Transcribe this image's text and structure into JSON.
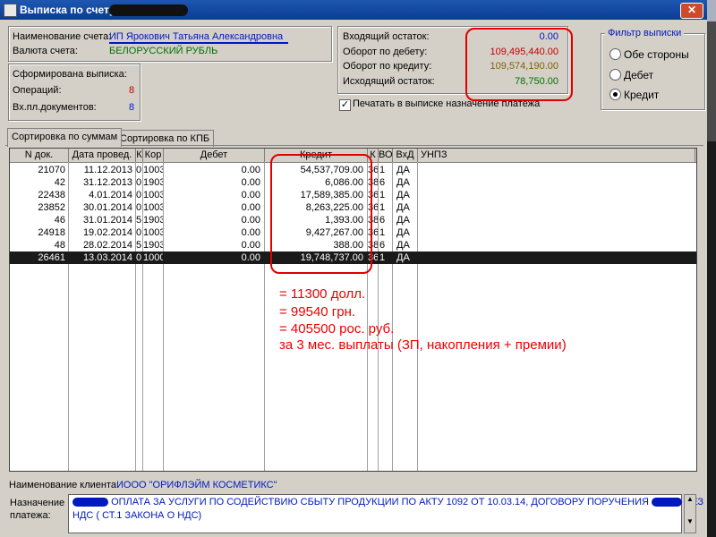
{
  "window": {
    "title": "Выписка по счету",
    "close_glyph": "✕"
  },
  "account": {
    "name_label": "Наименование счета:",
    "name_value": "ИП Ярокович Татьяна Александровна",
    "currency_label": "Валюта счета:",
    "currency_value": "БЕЛОРУССКИЙ РУБЛЬ"
  },
  "summary": {
    "title": "Сформирована выписка:",
    "operations_label": "Операций:",
    "operations_value": "8",
    "docs_label": "Вх.пл.документов:",
    "docs_value": "8"
  },
  "balances": {
    "opening_label": "Входящий остаток:",
    "opening_value": "0.00",
    "debit_label": "Оборот по дебету:",
    "debit_value": "109,495,440.00",
    "credit_label": "Оборот по кредиту:",
    "credit_value": "109,574,190.00",
    "closing_label": "Исходящий остаток:",
    "closing_value": "78,750.00"
  },
  "print_option": {
    "label": "Печатать в выписке назначение платежа",
    "checked": true
  },
  "filter": {
    "title": "Фильтр выписки",
    "options": [
      "Обе стороны",
      "Дебет",
      "Кредит"
    ],
    "selected": "Кредит"
  },
  "tabs": [
    {
      "label": "Сортировка по суммам",
      "active": true
    },
    {
      "label": "Сортировка по КПБ",
      "active": false
    }
  ],
  "table": {
    "columns": [
      "N док.",
      "Дата провед.",
      "К",
      "Кор",
      "Дебет",
      "Кредит",
      "К",
      "ВО",
      "ВхД",
      "УНПЗ"
    ],
    "rows": [
      [
        "21070",
        "11.12.2013",
        "0",
        "1003",
        "0.00",
        "54,537,709.00",
        "367",
        "1",
        "ДА",
        ""
      ],
      [
        "42",
        "31.12.2013",
        "0",
        "1903",
        "0.00",
        "6,086.00",
        "387",
        "6",
        "ДА",
        ""
      ],
      [
        "22438",
        "4.01.2014",
        "0",
        "1003",
        "0.00",
        "17,589,385.00",
        "367",
        "1",
        "ДА",
        ""
      ],
      [
        "23852",
        "30.01.2014",
        "0",
        "1003",
        "0.00",
        "8,263,225.00",
        "367",
        "1",
        "ДА",
        ""
      ],
      [
        "46",
        "31.01.2014",
        "5",
        "1903",
        "0.00",
        "1,393.00",
        "387",
        "6",
        "ДА",
        ""
      ],
      [
        "24918",
        "19.02.2014",
        "0",
        "1003",
        "0.00",
        "9,427,267.00",
        "367",
        "1",
        "ДА",
        ""
      ],
      [
        "48",
        "28.02.2014",
        "5",
        "1903",
        "0.00",
        "388.00",
        "387",
        "6",
        "ДА",
        ""
      ],
      [
        "26461",
        "13.03.2014",
        "0",
        "1000",
        "0.00",
        "19,748,737.00",
        "367",
        "1",
        "ДА",
        ""
      ]
    ],
    "selected_row": 7
  },
  "annotation": {
    "line1": "= 11300 долл.",
    "line2": "= 99540 грн.",
    "line3": "= 405500 рос. руб.",
    "line4": "за 3 мес. выплаты (ЗП, накопления + премии)"
  },
  "client": {
    "label": "Наименование клиента:",
    "value": "ИООО \"ОРИФЛЭЙМ КОСМЕТИКС\""
  },
  "purpose": {
    "label_line1": "Назначение",
    "label_line2": "платежа:",
    "line1": "ОПЛАТА ЗА УСЛУГИ ПО СОДЕЙСТВИЮ СБЫТУ ПРОДУКЦИИ ПО АКТУ 1092 ОТ 10.03.14, ДОГОВОРУ ПОРУЧЕНИЯ",
    "line1_tail": "БЕЗ",
    "line2": "НДС ( СТ.1 ЗАКОНА О НДС)"
  },
  "colors": {
    "accent_red": "#e00000",
    "value_blue": "#0018c0",
    "value_green": "#007000",
    "selection": "#1a1a1a"
  }
}
